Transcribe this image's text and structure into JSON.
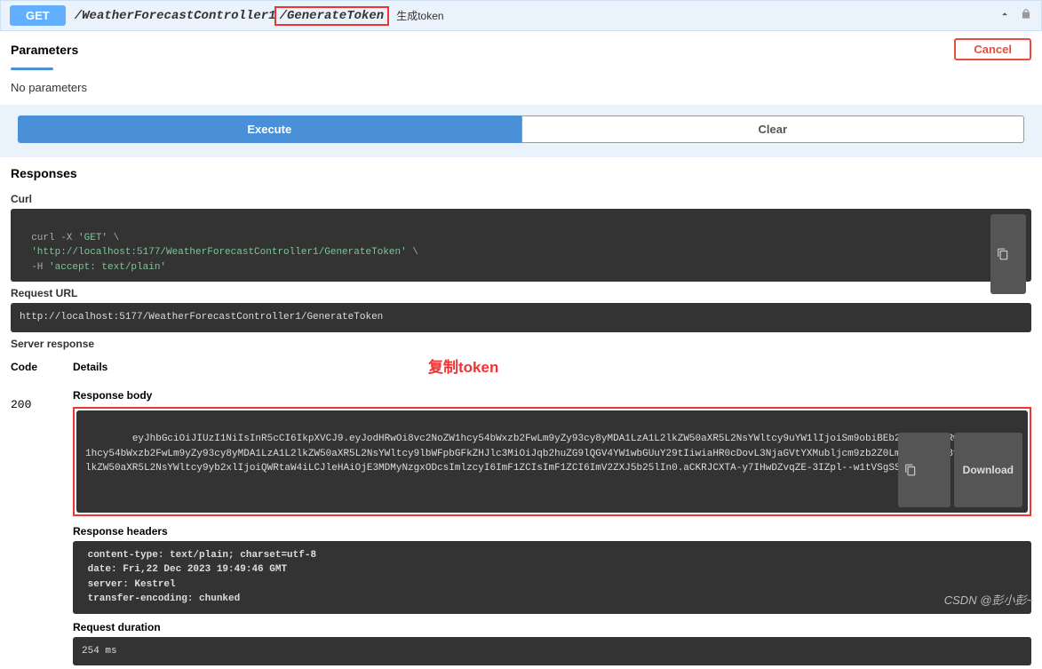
{
  "operation": {
    "method": "GET",
    "path_prefix": "/WeatherForecastController1",
    "path_highlighted": "/GenerateToken",
    "summary": "生成token"
  },
  "parameters": {
    "heading": "Parameters",
    "cancel_label": "Cancel",
    "empty_text": "No parameters"
  },
  "actions": {
    "execute_label": "Execute",
    "clear_label": "Clear"
  },
  "responses": {
    "heading": "Responses",
    "curl_label": "Curl",
    "curl_cmd_prefix": "curl -X ",
    "curl_method": "'GET'",
    "curl_url": "'http://localhost:5177/WeatherForecastController1/GenerateToken'",
    "curl_header_flag": "-H ",
    "curl_header": "'accept: text/plain'",
    "request_url_label": "Request URL",
    "request_url": "http://localhost:5177/WeatherForecastController1/GenerateToken",
    "server_response_label": "Server response",
    "code_header": "Code",
    "details_header": "Details",
    "status_code": "200",
    "response_body_label": "Response body",
    "response_body": "eyJhbGciOiJIUzI1NiIsInR5cCI6IkpXVCJ9.eyJodHRwOi8vc2NoZW1hcy54bWxzb2FwLm9yZy93cy8yMDA1LzA1L2lkZW50aXR5L2NsYWltcy9uYW1lIjoiSm9obiBEb2UiLCJodHRwOi8vc2NoZW1hcy54bWxzb2FwLm9yZy93cy8yMDA1LzA1L2lkZW50aXR5L2NsYWltcy9lbWFpbGFkZHJlc3MiOiJqb2huZG9lQGV4YW1wbGUuY29tIiwiaHR0cDovL3NjaGVtYXMubljcm9zb2Z0LmNvbS93cy8yMDA4LzA2L2lkZW50aXR5L2NsYWltcy9yb2xlIjoiQWRtaW4iLCJleHAiOjE3MDMyNzgxODcsImlzcyI6ImF1ZCIsImF1ZCI6ImV2ZXJ5b25lIn0.aCKRJCXTA-y7IHwDZvqZE-3IZpl--w1tVSgSSmlEjmY",
    "download_label": "Download",
    "annotation": "复制token",
    "response_headers_label": "Response headers",
    "headers": [
      {
        "key": "content-type: ",
        "value": "text/plain; charset=utf-8"
      },
      {
        "key": "date: ",
        "value": "Fri,22 Dec 2023 19:49:46 GMT"
      },
      {
        "key": "server: ",
        "value": "Kestrel"
      },
      {
        "key": "transfer-encoding: ",
        "value": "chunked"
      }
    ],
    "request_duration_label": "Request duration",
    "request_duration": "254 ms"
  },
  "watermark": "CSDN @彭小彭~"
}
